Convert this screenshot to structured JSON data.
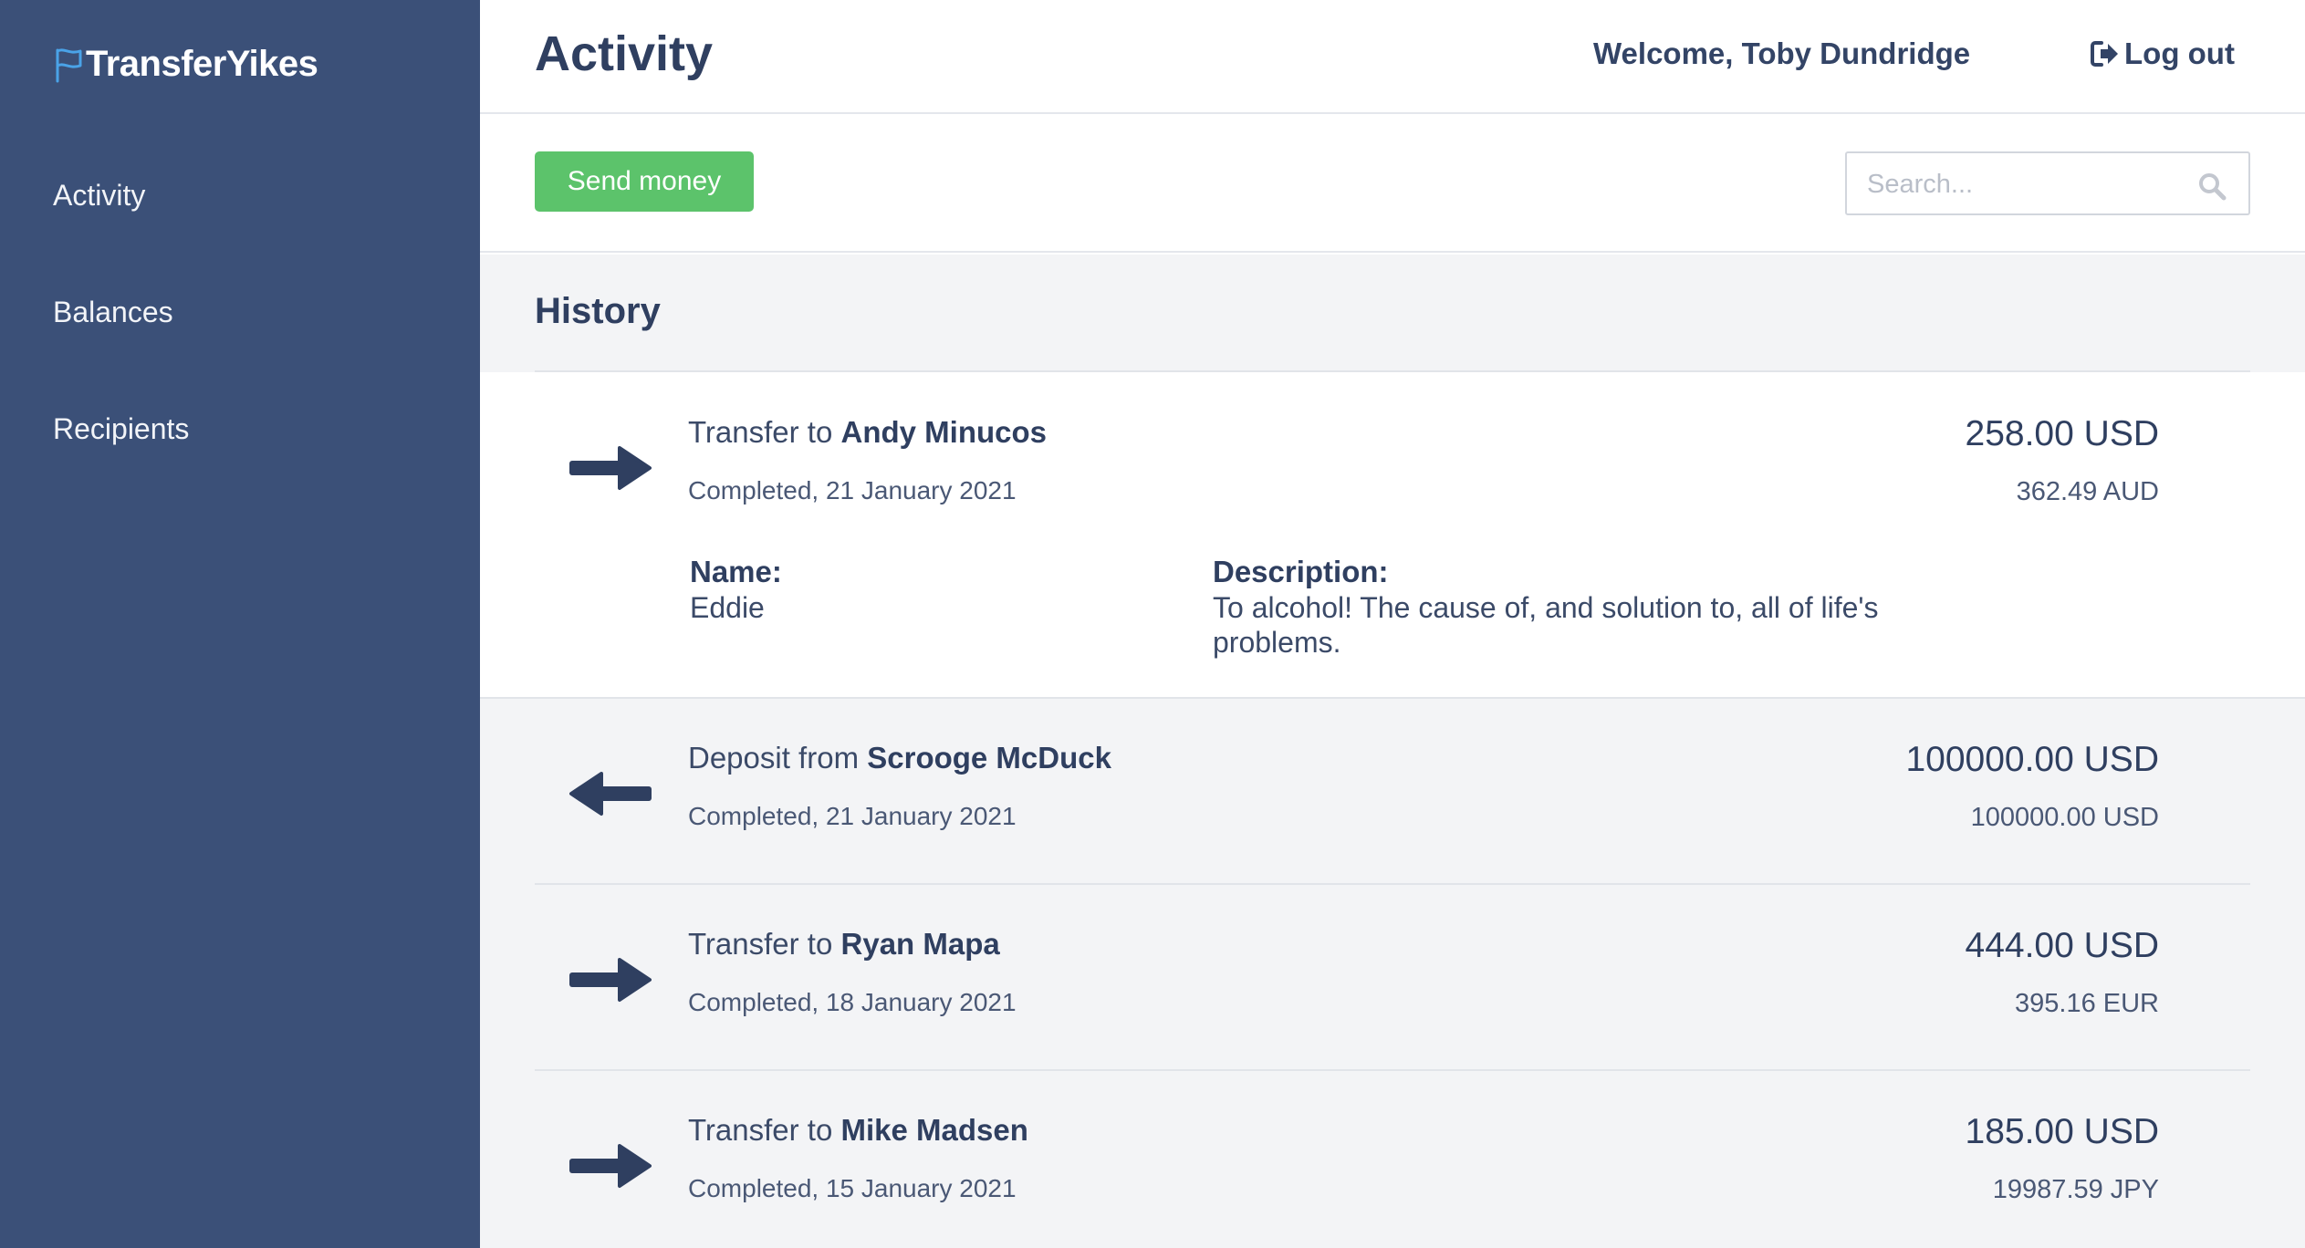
{
  "brand": {
    "name": "TransferYikes",
    "icon": "flag-icon"
  },
  "sidebar": {
    "items": [
      {
        "label": "Activity"
      },
      {
        "label": "Balances"
      },
      {
        "label": "Recipients"
      }
    ]
  },
  "header": {
    "title": "Activity",
    "welcome": "Welcome, Toby Dundridge",
    "logout_label": "Log out"
  },
  "toolbar": {
    "send_label": "Send money",
    "search_placeholder": "Search..."
  },
  "history": {
    "title": "History",
    "transactions": [
      {
        "direction": "outgoing",
        "prefix": "Transfer to",
        "party": "Andy Minucos",
        "status": "Completed, 21 January 2021",
        "amount": "258.00 USD",
        "converted": "362.49 AUD",
        "expanded": true,
        "name_label": "Name:",
        "name_value": "Eddie",
        "description_label": "Description:",
        "description_value": "To alcohol! The cause of, and solution to, all of life's problems."
      },
      {
        "direction": "incoming",
        "prefix": "Deposit from",
        "party": "Scrooge McDuck",
        "status": "Completed, 21 January 2021",
        "amount": "100000.00 USD",
        "converted": "100000.00 USD"
      },
      {
        "direction": "outgoing",
        "prefix": "Transfer to",
        "party": "Ryan Mapa",
        "status": "Completed, 18 January 2021",
        "amount": "444.00 USD",
        "converted": "395.16 EUR"
      },
      {
        "direction": "outgoing",
        "prefix": "Transfer to",
        "party": "Mike Madsen",
        "status": "Completed, 15 January 2021",
        "amount": "185.00 USD",
        "converted": "19987.59 JPY"
      }
    ]
  },
  "colors": {
    "sidebar": "#3b5078",
    "accent_green": "#5cc36b",
    "text_dark": "#2f3f60",
    "brand_flag": "#4aa3e8"
  }
}
